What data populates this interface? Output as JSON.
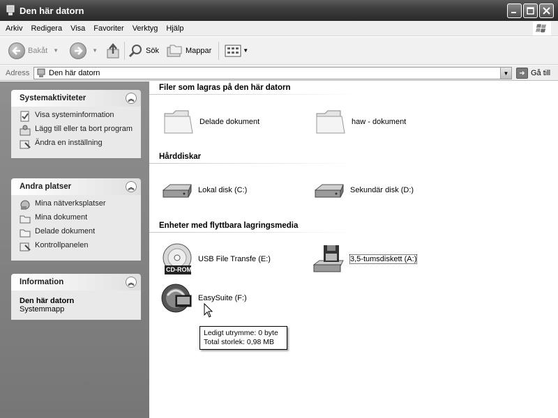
{
  "window": {
    "title": "Den här datorn"
  },
  "menu": [
    "Arkiv",
    "Redigera",
    "Visa",
    "Favoriter",
    "Verktyg",
    "Hjälp"
  ],
  "toolbar": {
    "back": "Bakåt",
    "search": "Sök",
    "folders": "Mappar"
  },
  "address": {
    "label": "Adress",
    "value": "Den här datorn",
    "go": "Gå till"
  },
  "sidebar": {
    "system_tasks": {
      "title": "Systemaktiviteter",
      "items": [
        "Visa systeminformation",
        "Lägg till eller ta bort program",
        "Ändra en inställning"
      ]
    },
    "other_places": {
      "title": "Andra platser",
      "items": [
        "Mina nätverksplatser",
        "Mina dokument",
        "Delade dokument",
        "Kontrollpanelen"
      ]
    },
    "information": {
      "title": "Information",
      "name": "Den här datorn",
      "type": "Systemmapp"
    }
  },
  "groups": {
    "files": {
      "title": "Filer som lagras på den här datorn",
      "items": [
        "Delade dokument",
        "haw - dokument"
      ]
    },
    "drives": {
      "title": "Hårddiskar",
      "items": [
        "Lokal disk (C:)",
        "Sekundär disk (D:)"
      ]
    },
    "removable": {
      "title": "Enheter med flyttbara lagringsmedia",
      "items": [
        "USB File Transfe (E:)",
        "3,5-tumsdiskett (A:)",
        "EasySuite (F:)"
      ],
      "cdrom_badge": "CD-ROM"
    }
  },
  "tooltip": {
    "line1": "Ledigt utrymme: 0 byte",
    "line2": "Total storlek: 0,98 MB"
  }
}
